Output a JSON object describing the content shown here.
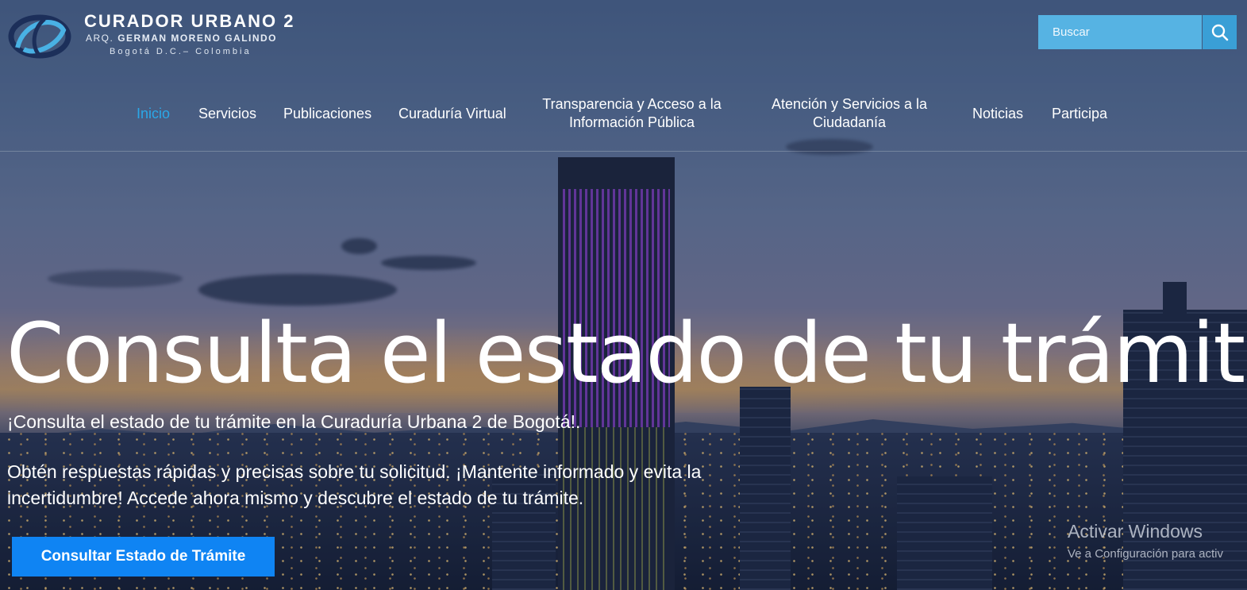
{
  "header": {
    "logo_title": "CURADOR URBANO 2",
    "logo_prefix": "ARQ.",
    "logo_name": "GERMAN MORENO GALINDO",
    "logo_location": "Bogotá D.C.– Colombia",
    "search_placeholder": "Buscar",
    "search_icon": "search-icon"
  },
  "nav": {
    "items": [
      {
        "label": "Inicio",
        "active": true
      },
      {
        "label": "Servicios"
      },
      {
        "label": "Publicaciones"
      },
      {
        "label": "Curaduría Virtual"
      },
      {
        "label": "Transparencia y Acceso a la",
        "label2": "Información Pública"
      },
      {
        "label": "Atención y Servicios a la",
        "label2": "Ciudadanía"
      },
      {
        "label": "Noticias"
      },
      {
        "label": "Participa"
      }
    ]
  },
  "hero": {
    "title": "Consulta el estado de tu trámite",
    "subtitle": "¡Consulta el estado de tu trámite en la Curaduría Urbana 2 de Bogotá!.",
    "description": "Obtén respuestas rápidas y precisas sobre tu solicitud. ¡Mantente informado y evita la incertidumbre! Accede ahora mismo y descubre el estado de tu trámite.",
    "cta_label": "Consultar Estado de Trámite"
  },
  "watermark": {
    "title": "Activar Windows",
    "subtitle": "Ve a Configuración para activ"
  },
  "colors": {
    "accent": "#2aa8e8",
    "search_bg": "#56b3e3",
    "search_btn": "#3a9fd6",
    "cta_bg": "#0f84f3"
  }
}
